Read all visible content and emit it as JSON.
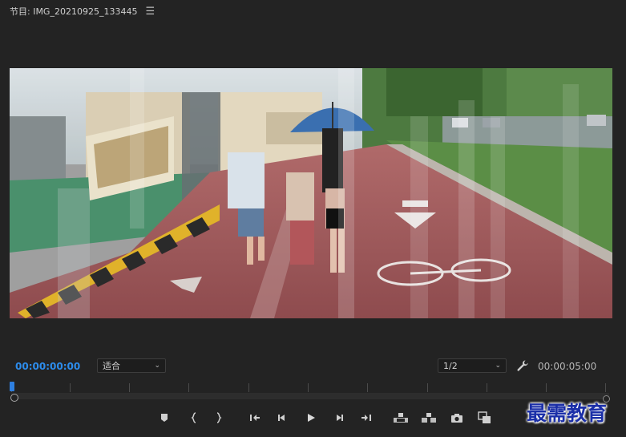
{
  "panel": {
    "title": "节目: IMG_20210925_133445",
    "menu_icon": "hamburger-menu-icon"
  },
  "viewer": {
    "content": "video-frame",
    "colors": {
      "sky": "#cfd7db",
      "lane": "#a0585a",
      "field": "#3f8a63",
      "tree": "#3f6b35"
    }
  },
  "transport": {
    "current_timecode": "00:00:00:00",
    "duration_timecode": "00:00:05:00",
    "zoom_select": "适合",
    "resolution_select": "1/2",
    "settings_icon": "wrench-icon",
    "accent_color": "#2d8ceb"
  },
  "buttons": [
    {
      "name": "add-marker-button",
      "icon": "marker-icon"
    },
    {
      "name": "mark-in-button",
      "icon": "mark-in-icon"
    },
    {
      "name": "mark-out-button",
      "icon": "mark-out-icon"
    },
    {
      "name": "go-to-in-button",
      "icon": "go-to-in-icon"
    },
    {
      "name": "step-back-button",
      "icon": "step-back-icon"
    },
    {
      "name": "play-button",
      "icon": "play-icon"
    },
    {
      "name": "step-forward-button",
      "icon": "step-forward-icon"
    },
    {
      "name": "go-to-out-button",
      "icon": "go-to-out-icon"
    },
    {
      "name": "lift-button",
      "icon": "lift-icon"
    },
    {
      "name": "extract-button",
      "icon": "extract-icon"
    },
    {
      "name": "export-frame-button",
      "icon": "camera-icon"
    },
    {
      "name": "compare-view-button",
      "icon": "compare-icon"
    }
  ],
  "watermark": "最需教育"
}
